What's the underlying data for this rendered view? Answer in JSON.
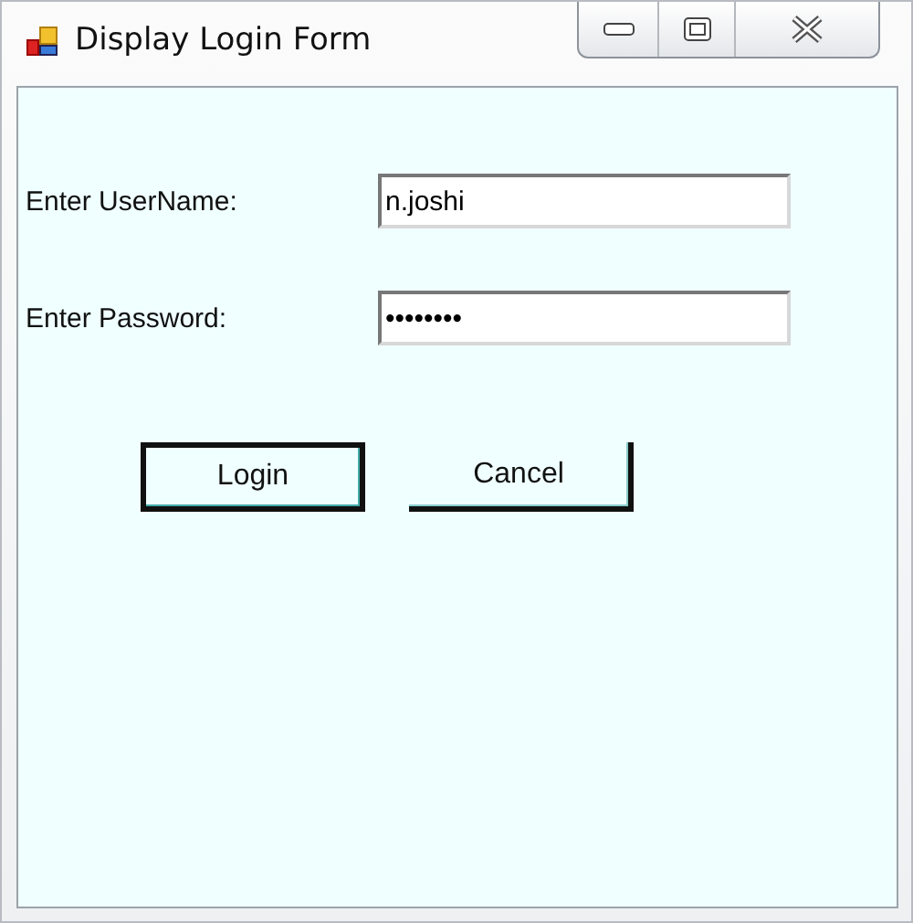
{
  "window": {
    "title": "Display Login Form"
  },
  "fields": [
    {
      "label": "Enter UserName:",
      "value": "n.joshi"
    },
    {
      "label": "Enter Password:",
      "value": "••••••••"
    }
  ],
  "buttons": [
    {
      "label": "Login",
      "selected": true
    },
    {
      "label": "Cancel",
      "selected": false
    }
  ]
}
